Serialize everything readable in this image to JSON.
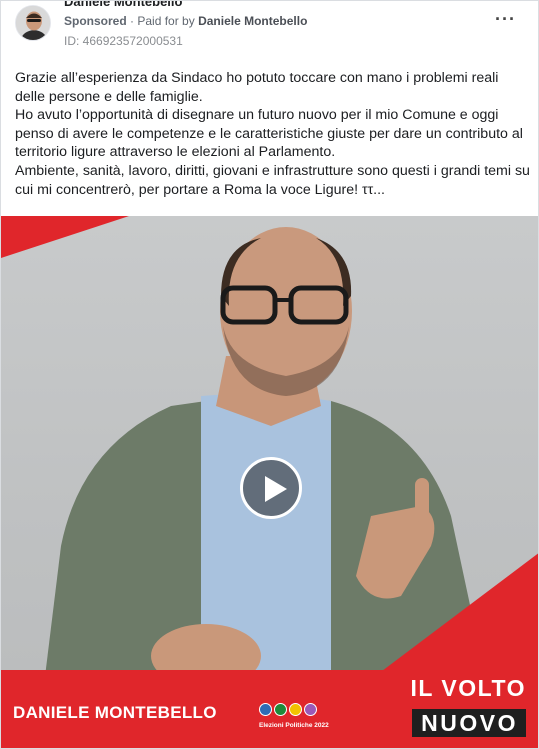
{
  "post": {
    "page_name": "Daniele Montebello",
    "sponsored_label": "Sponsored",
    "paid_prefix": "Paid for by",
    "payer": "Daniele Montebello",
    "ad_id": "ID: 466923572000531",
    "more_icon": "more-options-icon"
  },
  "body": {
    "lines": [
      "Grazie all’esperienza da Sindaco ho potuto toccare con mano i problemi reali delle persone e delle famiglie.",
      "Ho avuto l’opportunità di disegnare un futuro nuovo per il mio Comune e oggi penso di avere le competenze e le caratteristiche giuste per dare un contributo al territorio ligure attraverso le elezioni al Parlamento.",
      "Ambiente, sanità, lavoro, diritti, giovani e infrastrutture sono questi i grandi temi su cui mi concentrerò, per portare a Roma la voce Ligure! ττ..."
    ]
  },
  "video": {
    "lower_third_name": "DANIELE MONTEBELLO",
    "slogan_line1": "IL VOLTO",
    "slogan_line2": "NUOVO",
    "elections_label": "Elezioni Politiche 2022",
    "play_icon": "play-icon",
    "accent_color": "#e0262b"
  }
}
